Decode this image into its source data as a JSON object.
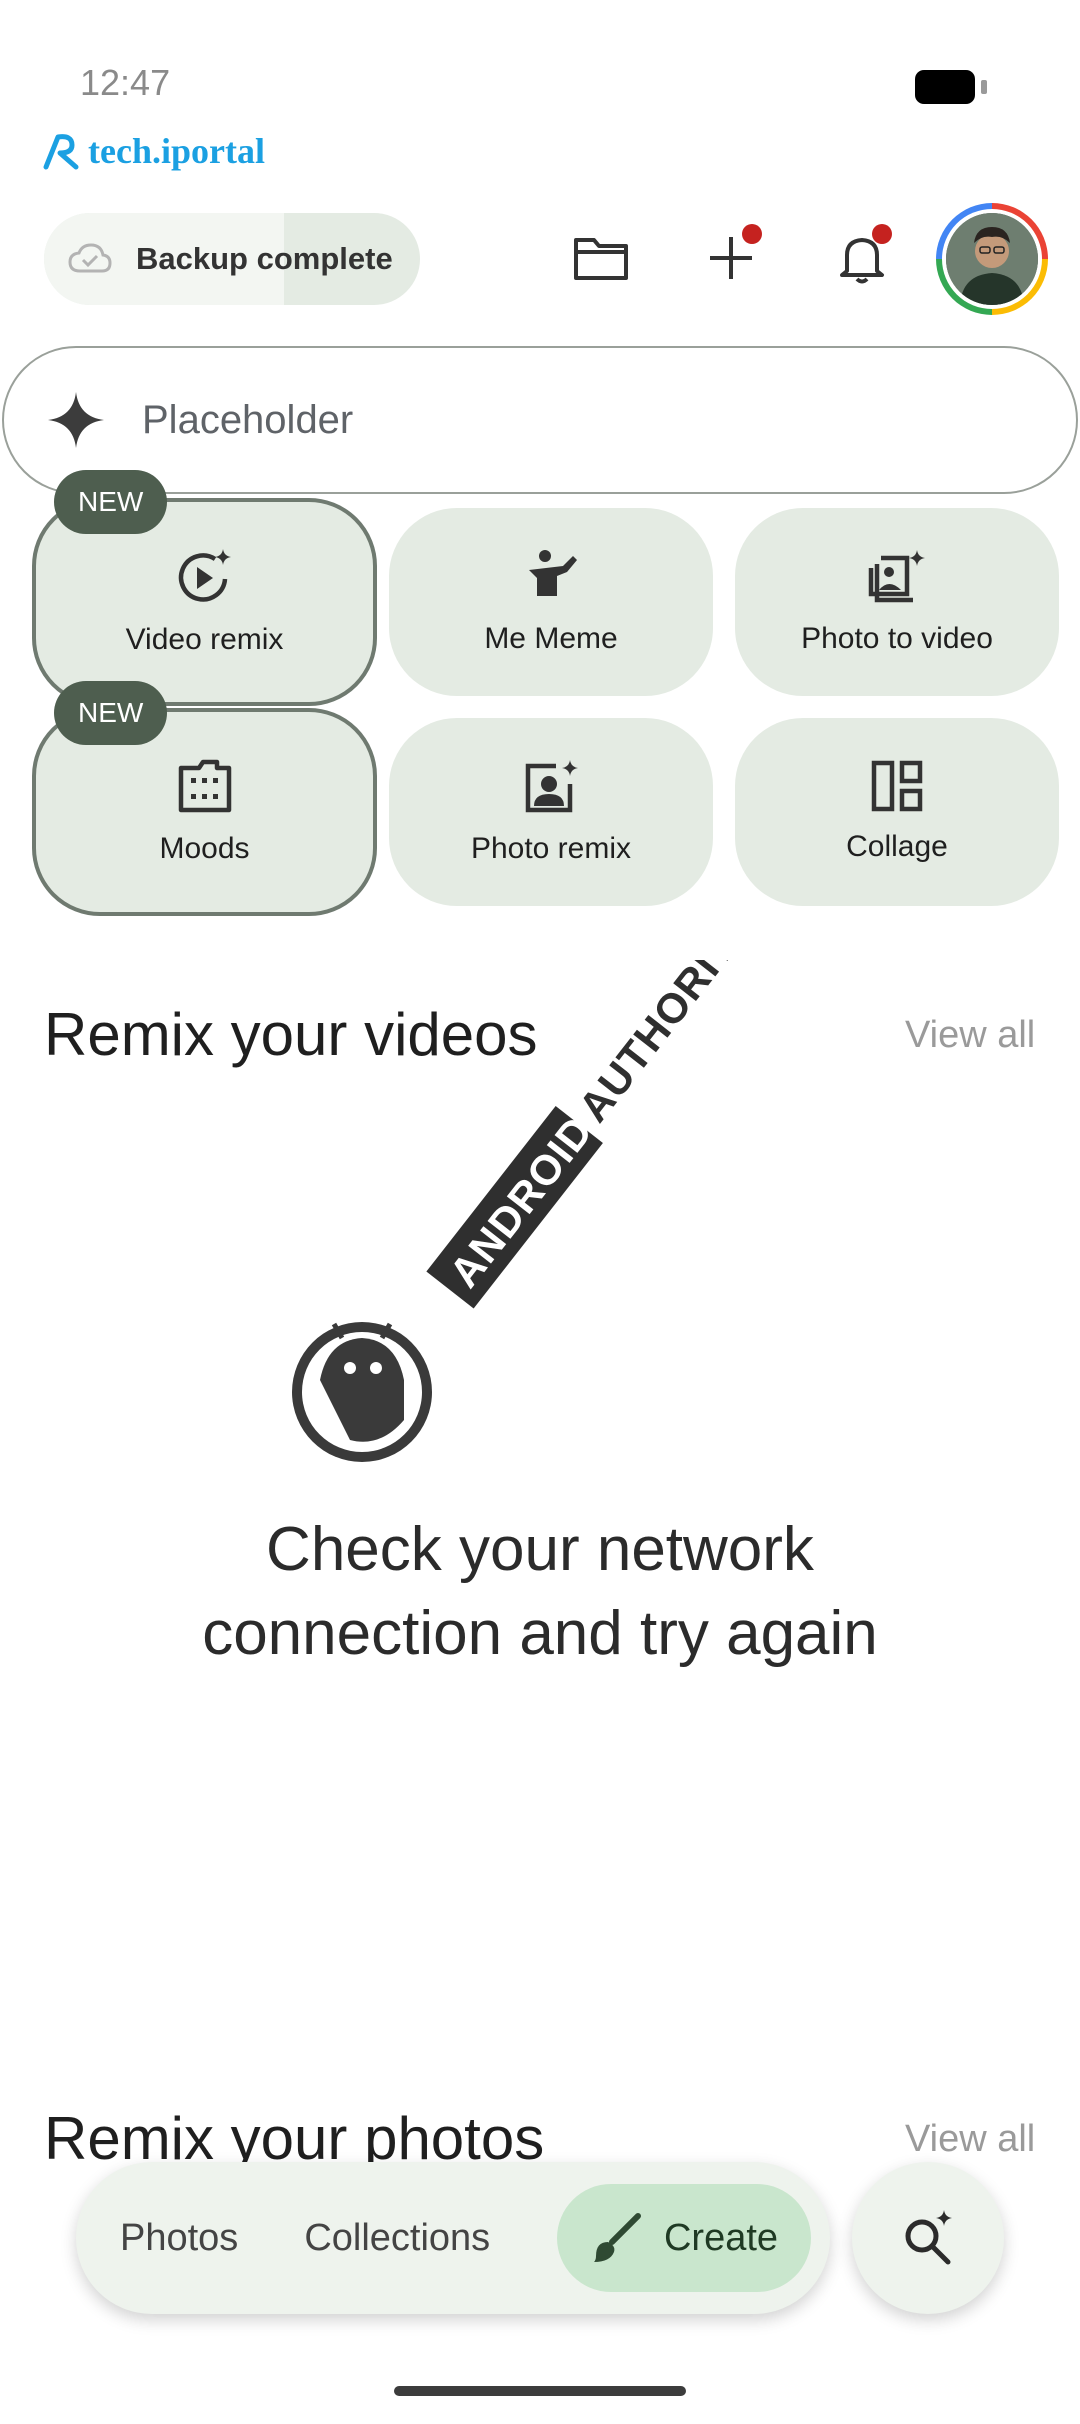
{
  "status_bar": {
    "time": "12:47"
  },
  "watermark": {
    "brand": "tech.iportal"
  },
  "header": {
    "backup_label": "Backup complete"
  },
  "search": {
    "placeholder": "Placeholder"
  },
  "badges": {
    "new": "NEW"
  },
  "tiles": [
    {
      "label": "Video remix",
      "icon": "video-sparkle-icon",
      "is_new": true
    },
    {
      "label": "Me Meme",
      "icon": "dab-person-icon",
      "is_new": false
    },
    {
      "label": "Photo to video",
      "icon": "photo-stack-sparkle-icon",
      "is_new": false
    },
    {
      "label": "Moods",
      "icon": "film-folder-icon",
      "is_new": true
    },
    {
      "label": "Photo remix",
      "icon": "portrait-sparkle-icon",
      "is_new": false
    },
    {
      "label": "Collage",
      "icon": "collage-layout-icon",
      "is_new": false
    }
  ],
  "sections": {
    "videos": {
      "title": "Remix your videos",
      "view_all": "View all"
    },
    "photos": {
      "title": "Remix your photos",
      "view_all": "View all"
    }
  },
  "error": {
    "line1": "Check your network",
    "line2": "connection and try again"
  },
  "overlay_watermark": {
    "text": "ANDROID AUTHORITY"
  },
  "bottom_nav": {
    "photos": "Photos",
    "collections": "Collections",
    "create": "Create"
  },
  "colors": {
    "accent_green": "#c9e6cd",
    "tile_bg": "#e4ebe3",
    "badge_bg": "#4e5e4f",
    "notification_dot": "#c5221f"
  }
}
